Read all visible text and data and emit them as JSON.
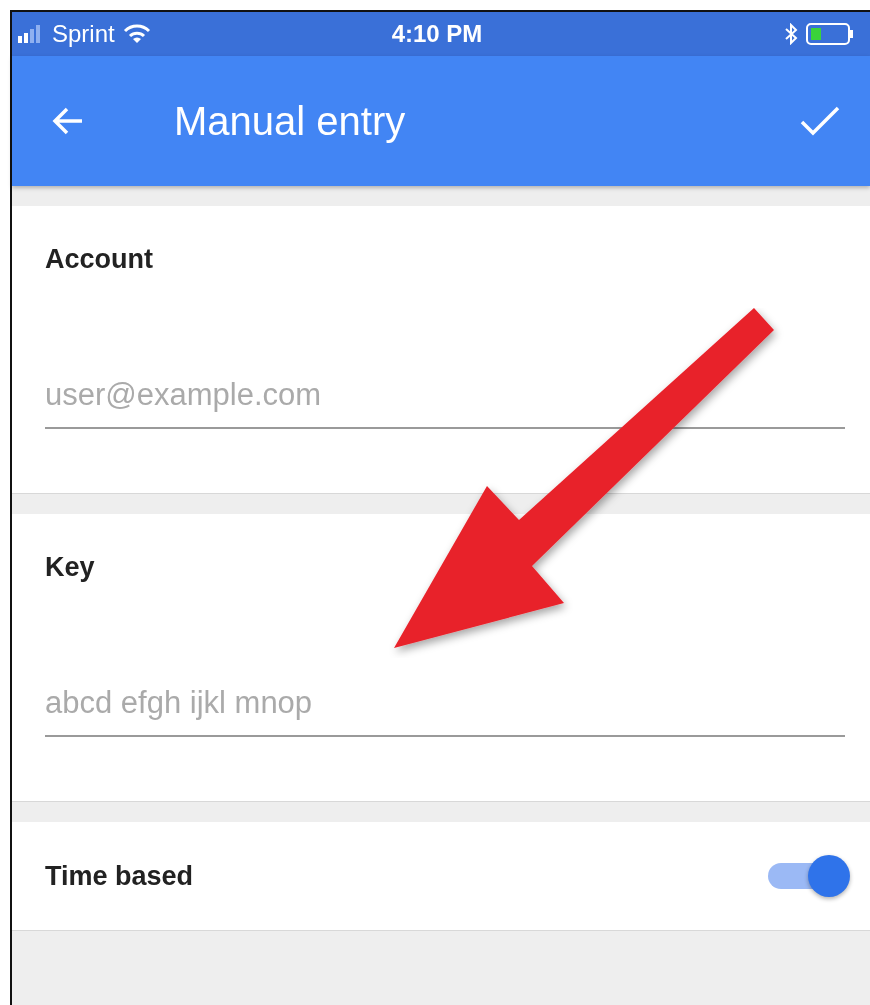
{
  "status_bar": {
    "carrier": "Sprint",
    "time": "4:10 PM"
  },
  "app_bar": {
    "title": "Manual entry"
  },
  "fields": [
    {
      "label": "Account",
      "placeholder": "user@example.com"
    },
    {
      "label": "Key",
      "placeholder": "abcd efgh ijkl mnop"
    }
  ],
  "settings": [
    {
      "label": "Time based",
      "on": true
    }
  ]
}
